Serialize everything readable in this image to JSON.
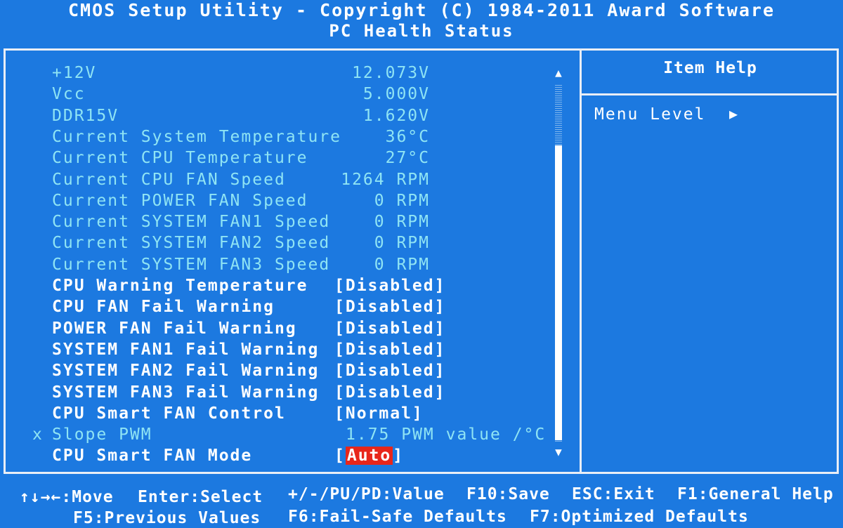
{
  "header": {
    "title": "CMOS Setup Utility - Copyright (C) 1984-2011 Award Software",
    "subtitle": "PC Health Status"
  },
  "rows": [
    {
      "label": "+12V",
      "value": "12.073V",
      "kind": "info"
    },
    {
      "label": "Vcc",
      "value": "5.000V",
      "kind": "info"
    },
    {
      "label": "DDR15V",
      "value": "1.620V",
      "kind": "info"
    },
    {
      "label": "Current System Temperature",
      "value": "36°C",
      "kind": "info"
    },
    {
      "label": "Current CPU Temperature",
      "value": "27°C",
      "kind": "info"
    },
    {
      "label": "Current CPU FAN Speed",
      "value": "1264 RPM",
      "kind": "info"
    },
    {
      "label": "Current POWER FAN Speed",
      "value": "0 RPM",
      "kind": "info"
    },
    {
      "label": "Current SYSTEM FAN1 Speed",
      "value": "0 RPM",
      "kind": "info"
    },
    {
      "label": "Current SYSTEM FAN2 Speed",
      "value": "0 RPM",
      "kind": "info"
    },
    {
      "label": "Current SYSTEM FAN3 Speed",
      "value": "0 RPM",
      "kind": "info"
    },
    {
      "label": "CPU Warning Temperature",
      "value": "[Disabled]",
      "kind": "setting"
    },
    {
      "label": "CPU FAN Fail Warning",
      "value": "[Disabled]",
      "kind": "setting"
    },
    {
      "label": "POWER FAN Fail Warning",
      "value": "[Disabled]",
      "kind": "setting"
    },
    {
      "label": "SYSTEM FAN1 Fail Warning",
      "value": "[Disabled]",
      "kind": "setting"
    },
    {
      "label": "SYSTEM FAN2 Fail Warning",
      "value": "[Disabled]",
      "kind": "setting"
    },
    {
      "label": "SYSTEM FAN3 Fail Warning",
      "value": "[Disabled]",
      "kind": "setting"
    },
    {
      "label": "CPU Smart FAN Control",
      "value": "[Normal]",
      "kind": "setting"
    },
    {
      "label": "Slope PWM",
      "value": "1.75 PWM value /°C",
      "kind": "disabled",
      "marker": "x"
    },
    {
      "label": "CPU Smart FAN Mode",
      "value_open": "[",
      "value": "Auto",
      "value_close": "]",
      "kind": "selected"
    }
  ],
  "help": {
    "title": "Item Help",
    "menu_level": "Menu Level",
    "arrow": "▶"
  },
  "scroll": {
    "up": "▲",
    "down": "▼"
  },
  "footer": {
    "move": "↑↓→←:Move",
    "select": "Enter:Select",
    "value": "+/-/PU/PD:Value",
    "save": "F10:Save",
    "exit": "ESC:Exit",
    "general_help": "F1:General Help",
    "previous": "F5:Previous Values",
    "failsafe": "F6:Fail-Safe Defaults",
    "optimized": "F7:Optimized Defaults"
  },
  "colors": {
    "background": "#1c79e0",
    "info_text": "#8fe4f4",
    "setting_text": "#ffffff",
    "highlight": "#e8261b"
  }
}
